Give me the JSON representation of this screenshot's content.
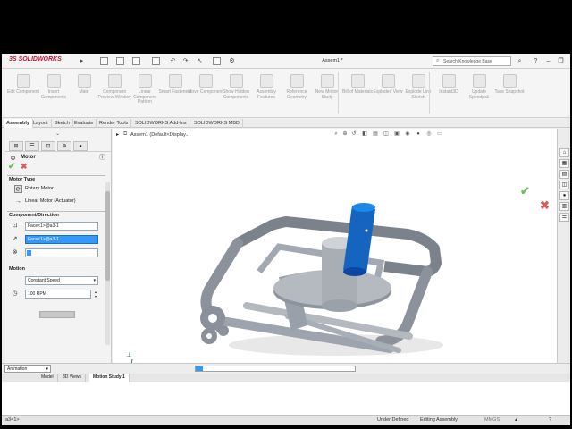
{
  "app": {
    "logo_text": "SOLIDWORKS",
    "document_title": "Assem1 *",
    "search_placeholder": "Search Knowledge Base"
  },
  "command_manager": [
    {
      "label": "Edit Component",
      "icon": "edit-component-icon"
    },
    {
      "label": "Insert Components",
      "icon": "insert-components-icon"
    },
    {
      "label": "Mate",
      "icon": "mate-icon"
    },
    {
      "label": "Component Preview Window",
      "icon": "preview-window-icon"
    },
    {
      "label": "Linear Component Pattern",
      "icon": "linear-pattern-icon"
    },
    {
      "label": "Smart Fasteners",
      "icon": "smart-fasteners-icon"
    },
    {
      "label": "Move Component",
      "icon": "move-component-icon"
    },
    {
      "label": "Show Hidden Components",
      "icon": "show-hidden-icon"
    },
    {
      "label": "Assembly Features",
      "icon": "assembly-features-icon"
    },
    {
      "label": "Reference Geometry",
      "icon": "reference-geometry-icon"
    },
    {
      "label": "New Motion Study",
      "icon": "new-motion-study-icon"
    },
    {
      "label": "Bill of Materials",
      "icon": "bom-icon"
    },
    {
      "label": "Exploded View",
      "icon": "exploded-view-icon"
    },
    {
      "label": "Explode Line Sketch",
      "icon": "explode-line-icon"
    },
    {
      "label": "Instant3D",
      "icon": "instant3d-icon"
    },
    {
      "label": "Update Speedpak",
      "icon": "speedpak-icon"
    },
    {
      "label": "Take Snapshot",
      "icon": "snapshot-icon"
    }
  ],
  "tabs": [
    "Assembly",
    "Layout",
    "Sketch",
    "Evaluate",
    "Render Tools",
    "SOLIDWORKS Add-Ins",
    "SOLIDWORKS MBD"
  ],
  "active_tab": "Assembly",
  "property_manager": {
    "title": "Motor",
    "motor_type_header": "Motor Type",
    "rotary_motor": "Rotary Motor",
    "linear_motor": "Linear Motor (Actuator)",
    "component_direction_header": "Component/Direction",
    "face_1": "Face<1>@a3-1",
    "face_2": "Face<1>@a3-1",
    "motion_header": "Motion",
    "motion_type": "Constant Speed",
    "speed": "100 RPM"
  },
  "viewport": {
    "tree_root": "Assem1 (Default<Display..."
  },
  "motion_manager": {
    "study_type": "Animation",
    "tabs": [
      "Model",
      "3D Views",
      "Motion Study 1"
    ],
    "active_tab": "Motion Study 1"
  },
  "status_bar": {
    "left": "a3<1>",
    "under_defined": "Under Defined",
    "editing": "Editing Assembly",
    "units": "MMGS"
  },
  "colors": {
    "selected_field": "#3399ff",
    "motor_cylinder": "#1565c0",
    "part_gray": "#9da3ad",
    "accept_green": "#6cbf5f",
    "cancel_red": "#d06060",
    "logo_red": "#c8102e"
  }
}
